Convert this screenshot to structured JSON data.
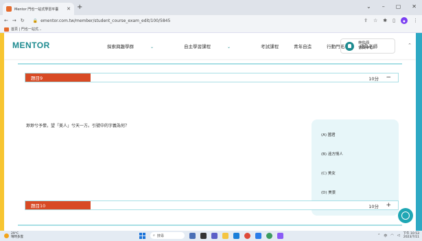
{
  "browser": {
    "tab_title": "Mentor 門也一站式學習平臺",
    "new_tab": "+",
    "url": "ementor.com.tw/member/student_course_exam_edit/100/5845",
    "bookmark": "首頁 | 門也一站式...",
    "window_controls": [
      "⌄",
      "–",
      "▢",
      "✕"
    ]
  },
  "site": {
    "logo": "MENTOR",
    "menu": [
      {
        "label": "探索興趣學群",
        "caret": "⌄"
      },
      {
        "label": "自主學習課程",
        "caret": "⌄"
      },
      {
        "label": "考試課程",
        "caret": ""
      },
      {
        "label": "青年自造",
        "caret": ""
      },
      {
        "label": "行動門拓",
        "caret": ""
      },
      {
        "label": "成為老師",
        "caret": ""
      }
    ],
    "user_name": "林佑辰",
    "user_role": "會員中心"
  },
  "questions": [
    {
      "label": "題目9",
      "score": "10分",
      "toggle": "−"
    },
    {
      "label": "題目10",
      "score": "10分",
      "toggle": "+"
    }
  ],
  "question9": {
    "text": "渺渺兮予懷，望「美人」兮天一方。引號中的字義為何？",
    "options": [
      "(A) 國君",
      "(B) 遠方情人",
      "(C) 美女",
      "(D) 美景"
    ]
  },
  "taskbar": {
    "temp": "29°C",
    "weather": "晴時多雲",
    "search": "搜尋",
    "time": "下午 10:53",
    "date": "2023/7/11"
  },
  "colors": {
    "accent": "#1c8a8f",
    "question_label": "#d84a24",
    "frame": "#f7c531"
  }
}
